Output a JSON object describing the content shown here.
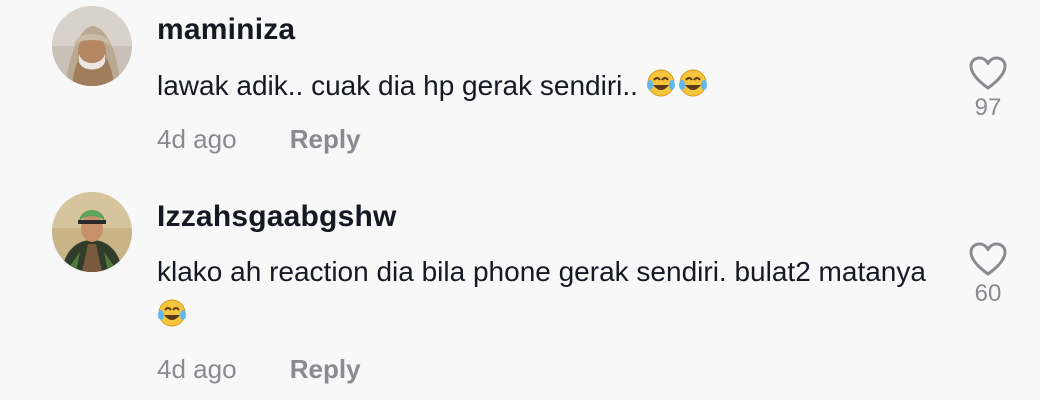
{
  "comments": [
    {
      "username": "maminiza",
      "text": "lawak adik.. cuak dia hp gerak sendiri..",
      "emoji": "😂😂",
      "time": "4d ago",
      "reply_label": "Reply",
      "likes": "97"
    },
    {
      "username": "Izzahsgaabgshw",
      "text": "klako ah reaction dia bila phone gerak sendiri. bulat2 matanya",
      "emoji": "😂",
      "time": "4d ago",
      "reply_label": "Reply",
      "likes": "60"
    }
  ],
  "icons": {
    "like": "heart-outline-icon",
    "emoji": "face-with-tears-of-joy-icon"
  },
  "colors": {
    "background": "#f8f8f8",
    "text": "#161823",
    "muted": "#8a8b91"
  }
}
